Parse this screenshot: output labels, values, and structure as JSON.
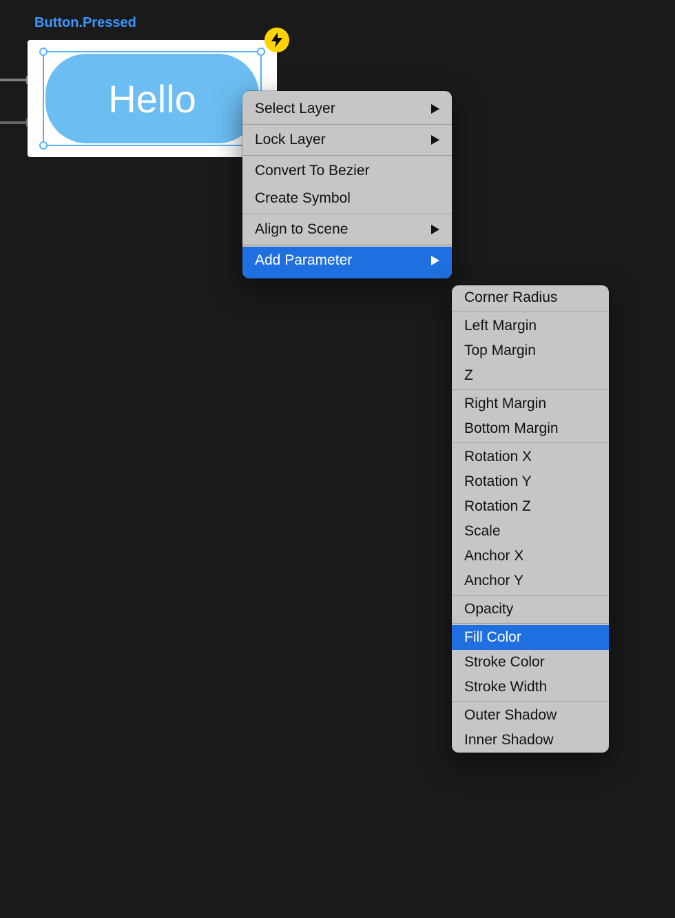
{
  "canvas": {
    "state_label": "Button.Pressed",
    "element_text": "Hello",
    "badge_icon": "bolt-icon"
  },
  "colors": {
    "canvas_bg": "#1a1a1a",
    "accent": "#1f6fe0",
    "link": "#3d97ff",
    "pill": "#6cbdf2",
    "badge": "#ffd400"
  },
  "context_menu": {
    "select_layer": "Select Layer",
    "lock_layer": "Lock Layer",
    "convert_bezier": "Convert To Bezier",
    "create_symbol": "Create Symbol",
    "align_scene": "Align to Scene",
    "add_parameter": "Add Parameter"
  },
  "parameters_submenu": {
    "groups": [
      [
        "Corner Radius"
      ],
      [
        "Left Margin",
        "Top Margin",
        "Z"
      ],
      [
        "Right Margin",
        "Bottom Margin"
      ],
      [
        "Rotation X",
        "Rotation Y",
        "Rotation Z",
        "Scale",
        "Anchor X",
        "Anchor Y"
      ],
      [
        "Opacity"
      ],
      [
        "Fill Color",
        "Stroke Color",
        "Stroke Width"
      ],
      [
        "Outer Shadow",
        "Inner Shadow"
      ]
    ],
    "highlighted": "Fill Color"
  }
}
